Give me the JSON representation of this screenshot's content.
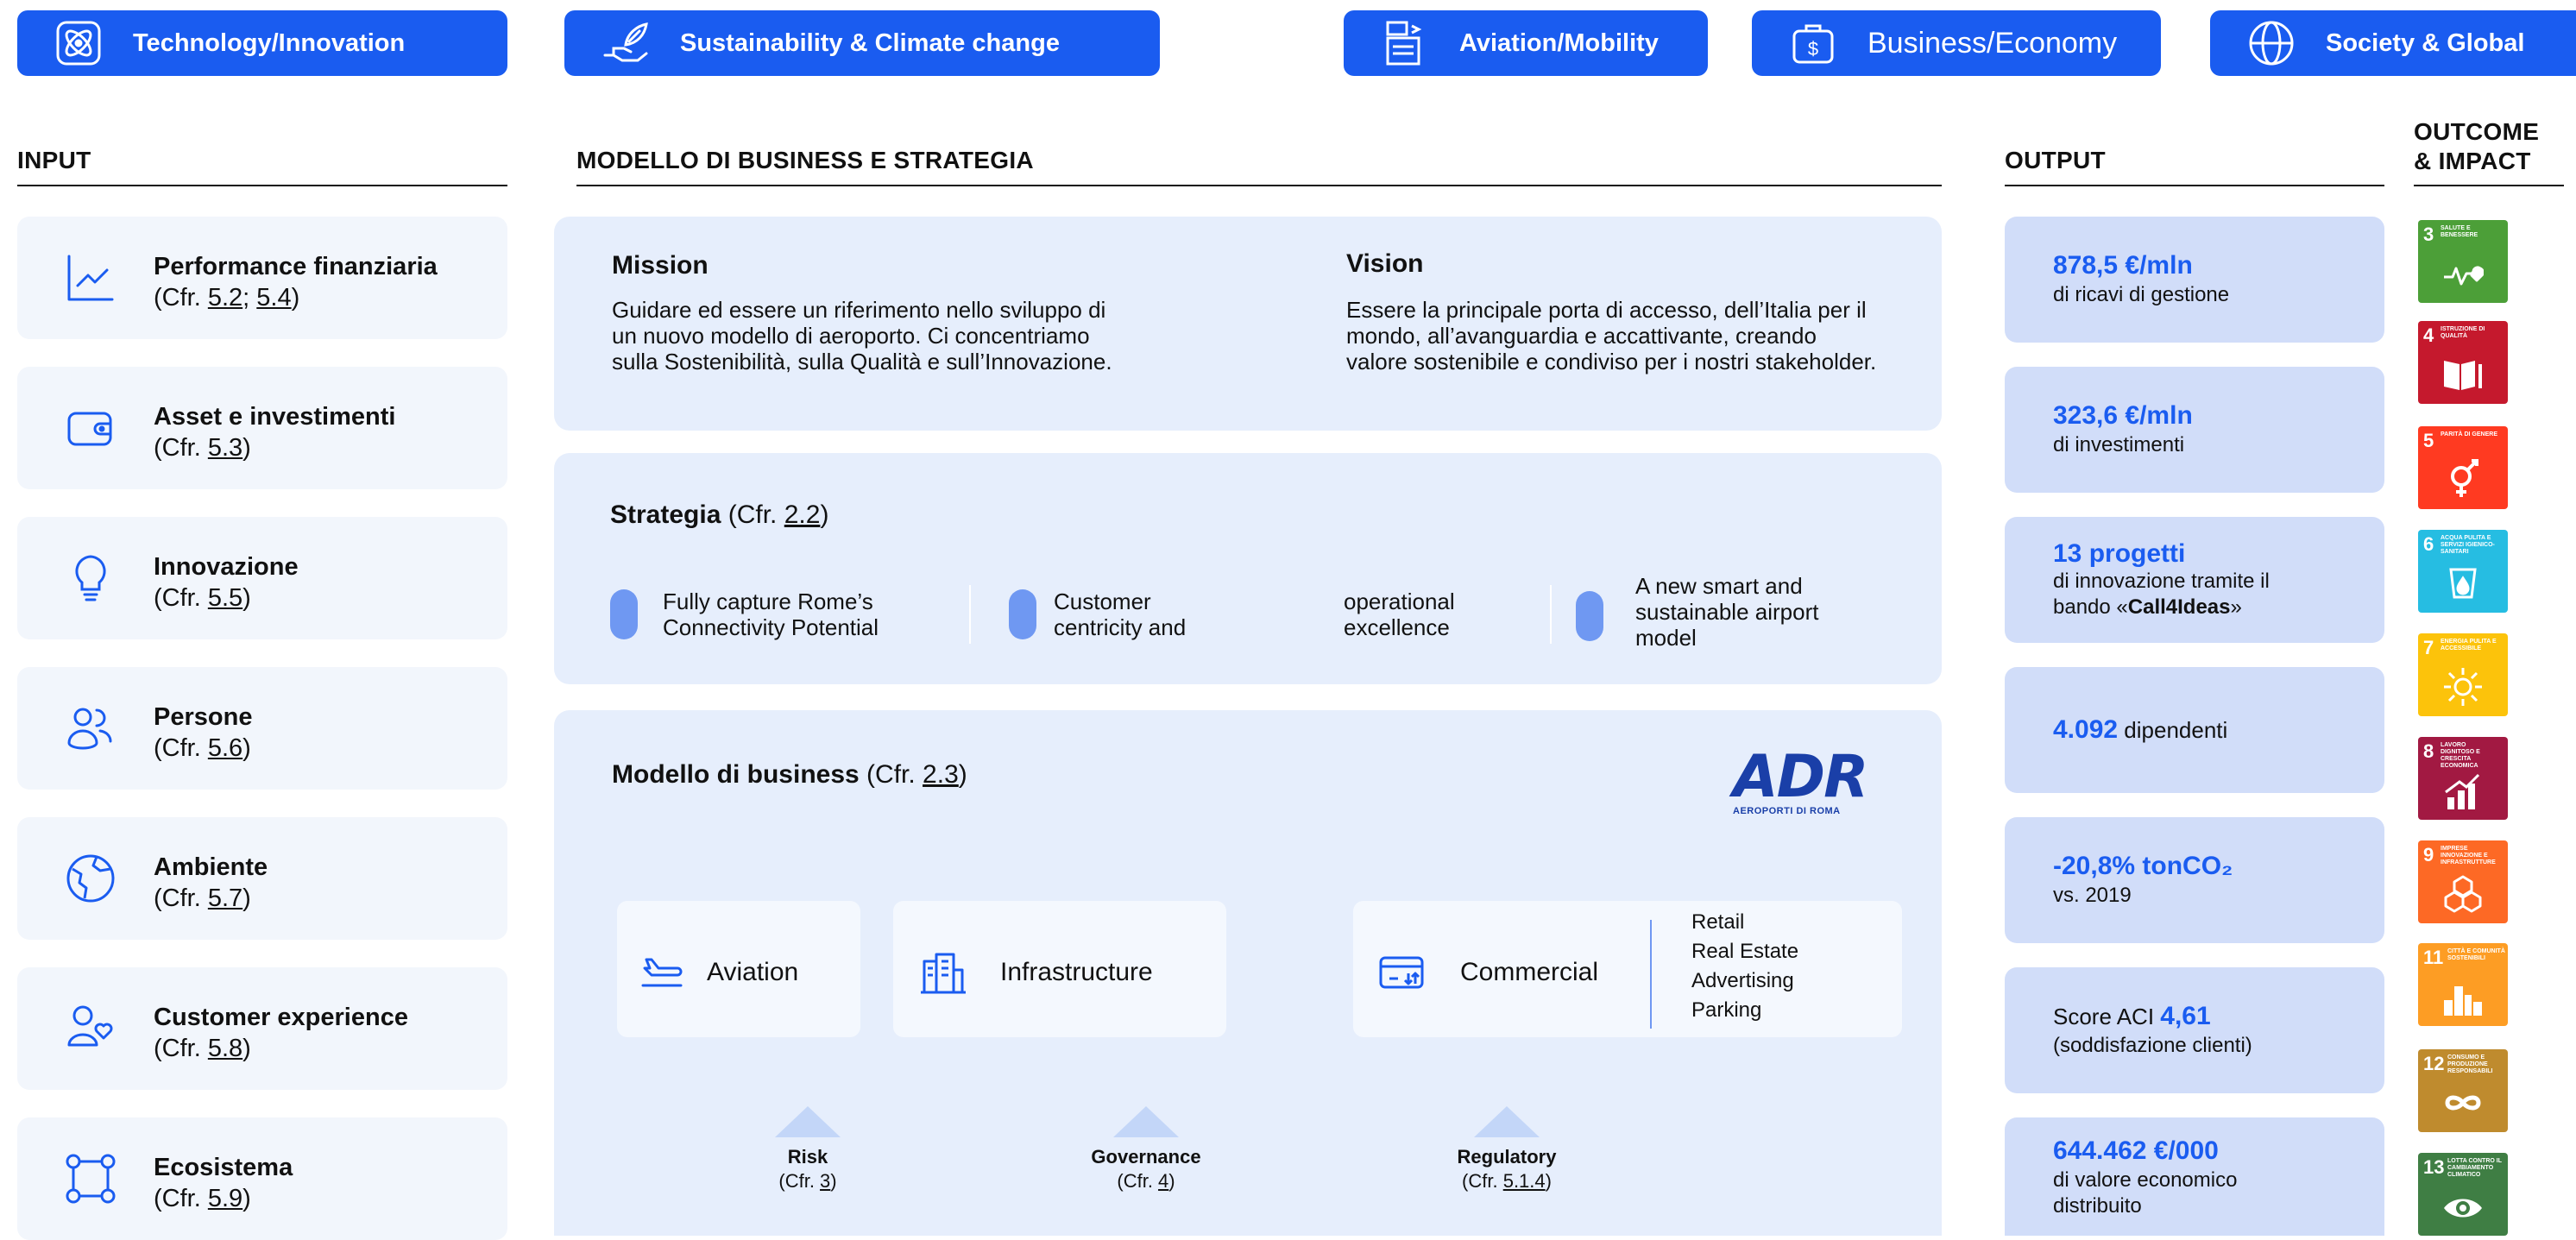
{
  "categories": [
    {
      "label": "Technology/Innovation",
      "icon": "atom-icon"
    },
    {
      "label": "Sustainability & Climate change",
      "icon": "hand-leaf-icon"
    },
    {
      "label": "Aviation/Mobility",
      "icon": "airport-board-icon"
    },
    {
      "label": "Business/Economy",
      "icon": "briefcase-dollar-icon"
    },
    {
      "label": "Society & Global",
      "icon": "globe-icon"
    }
  ],
  "headers": {
    "input": "INPUT",
    "business": "MODELLO DI BUSINESS E STRATEGIA",
    "output": "OUTPUT",
    "outcome_1": "OUTCOME",
    "outcome_2": "& IMPACT"
  },
  "inputs": [
    {
      "title": "Performance finanziaria",
      "ref_prefix": "(Cfr. ",
      "ref_a": "5.2",
      "ref_mid": "; ",
      "ref_b": "5.4",
      "ref_suffix": ")",
      "icon": "line-chart-icon"
    },
    {
      "title": "Asset e investimenti",
      "ref_prefix": "(Cfr. ",
      "ref_a": "5.3",
      "ref_suffix": ")",
      "icon": "wallet-icon"
    },
    {
      "title": "Innovazione",
      "ref_prefix": "(Cfr. ",
      "ref_a": "5.5",
      "ref_suffix": ")",
      "icon": "lightbulb-icon"
    },
    {
      "title": "Persone",
      "ref_prefix": "(Cfr. ",
      "ref_a": "5.6",
      "ref_suffix": ")",
      "icon": "people-icon"
    },
    {
      "title": "Ambiente",
      "ref_prefix": "(Cfr. ",
      "ref_a": "5.7",
      "ref_suffix": ")",
      "icon": "earth-icon"
    },
    {
      "title": "Customer experience",
      "ref_prefix": "(Cfr. ",
      "ref_a": "5.8",
      "ref_suffix": ")",
      "icon": "person-heart-icon"
    },
    {
      "title": "Ecosistema",
      "ref_prefix": "(Cfr. ",
      "ref_a": "5.9",
      "ref_suffix": ")",
      "icon": "network-icon"
    }
  ],
  "mission": {
    "title": "Mission",
    "line1": "Guidare ed essere un riferimento nello sviluppo di",
    "line2": "un nuovo modello di aeroporto. Ci concentriamo",
    "line3": "sulla Sostenibilità, sulla Qualità e sull’Innovazione."
  },
  "vision": {
    "title": "Vision",
    "line1": "Essere la principale porta di accesso, dell’Italia per il",
    "line2": "mondo, all’avanguardia e accattivante, creando",
    "line3": "valore sostenibile e condiviso per i nostri stakeholder."
  },
  "strategy": {
    "title": "Strategia",
    "ref_prefix": " (Cfr. ",
    "ref": "2.2",
    "ref_suffix": ")",
    "p1_l1": "Fully capture Rome’s",
    "p1_l2": "Connectivity Potential",
    "p2_l1": "Customer",
    "p2_l2": "centricity and",
    "p3_l1": "operational",
    "p3_l2": "excellence",
    "p4_l1": "A new smart and",
    "p4_l2": "sustainable airport",
    "p4_l3": "model"
  },
  "business_model": {
    "title": "Modello di business",
    "ref_prefix": " (Cfr. ",
    "ref": "2.3",
    "ref_suffix": ")",
    "logo_text": "ADR",
    "logo_sub": "AEROPORTI DI ROMA",
    "aviation": "Aviation",
    "infrastructure": "Infrastructure",
    "commercial": "Commercial",
    "commercial_items": [
      "Retail",
      "Real Estate",
      "Advertising",
      "Parking"
    ],
    "refs": [
      {
        "title": "Risk",
        "prefix": "(Cfr. ",
        "num": "3",
        "suffix": ")"
      },
      {
        "title": "Governance",
        "prefix": "(Cfr. ",
        "num": "4",
        "suffix": ")"
      },
      {
        "title": "Regulatory",
        "prefix": "(Cfr. ",
        "num": "5.1.4",
        "suffix": ")"
      }
    ]
  },
  "outputs": [
    {
      "big": "878,5 €/mln",
      "sub": "di ricavi di gestione"
    },
    {
      "big": "323,6 €/mln",
      "sub": "di investimenti"
    },
    {
      "big": "13 progetti",
      "sub1": "di innovazione tramite il",
      "sub2_pre": "bando «",
      "sub2_bold": "Call4Ideas",
      "sub2_post": "»"
    },
    {
      "big": "4.092",
      "sub_inline": " dipendenti"
    },
    {
      "big": "-20,8% tonCO₂",
      "sub": "vs. 2019"
    },
    {
      "pre": "Score ACI ",
      "big": "4,61",
      "sub": "(soddisfazione  clienti)"
    },
    {
      "big": "644.462 €/000",
      "sub1": "di valore economico",
      "sub2": "distribuito"
    }
  ],
  "sdgs": [
    {
      "num": "3",
      "caption": "SALUTE E BENESSERE",
      "color": "#4c9f38",
      "icon": "heartbeat-icon"
    },
    {
      "num": "4",
      "caption": "ISTRUZIONE DI QUALITÀ",
      "color": "#c5192d",
      "icon": "book-icon"
    },
    {
      "num": "5",
      "caption": "PARITÀ DI GENERE",
      "color": "#ff3a21",
      "icon": "gender-icon"
    },
    {
      "num": "6",
      "caption": "ACQUA PULITA E SERVIZI IGIENICO-SANITARI",
      "color": "#26bde2",
      "icon": "water-icon"
    },
    {
      "num": "7",
      "caption": "ENERGIA PULITA E ACCESSIBILE",
      "color": "#fcc30b",
      "icon": "sun-icon"
    },
    {
      "num": "8",
      "caption": "LAVORO DIGNITOSO E CRESCITA ECONOMICA",
      "color": "#a21942",
      "icon": "growth-chart-icon"
    },
    {
      "num": "9",
      "caption": "IMPRESE INNOVAZIONE E INFRASTRUTTURE",
      "color": "#fd6925",
      "icon": "cubes-icon"
    },
    {
      "num": "11",
      "caption": "CITTÀ E COMUNITÀ SOSTENIBILI",
      "color": "#fd9d24",
      "icon": "city-icon"
    },
    {
      "num": "12",
      "caption": "CONSUMO E PRODUZIONE RESPONSABILI",
      "color": "#bf8b2e",
      "icon": "infinity-icon"
    },
    {
      "num": "13",
      "caption": "LOTTA CONTRO IL CAMBIAMENTO CLIMATICO",
      "color": "#3f7e44",
      "icon": "eye-earth-icon"
    }
  ]
}
